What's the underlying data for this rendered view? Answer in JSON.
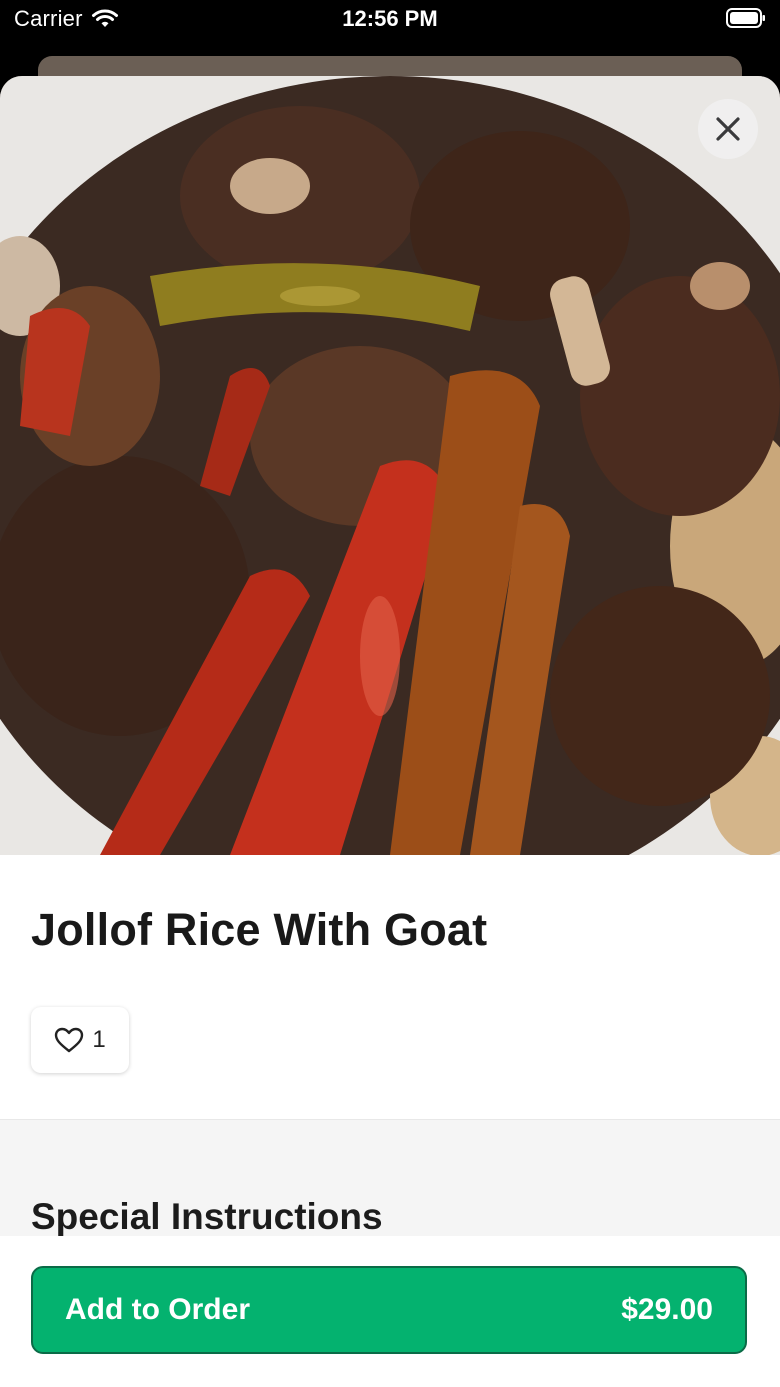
{
  "status_bar": {
    "carrier": "Carrier",
    "time": "12:56 PM"
  },
  "hero": {
    "image": "jollof-rice-with-goat-photo",
    "close_icon": "close-icon"
  },
  "item": {
    "title": "Jollof Rice With Goat",
    "likes": "1",
    "like_icon": "heart-outline-icon"
  },
  "special_instructions": {
    "title": "Special Instructions"
  },
  "footer": {
    "add_label": "Add to Order",
    "price": "$29.00"
  },
  "colors": {
    "accent": "#04b26f",
    "accent_border": "#0b6b47",
    "background_gray": "#f5f5f5"
  }
}
